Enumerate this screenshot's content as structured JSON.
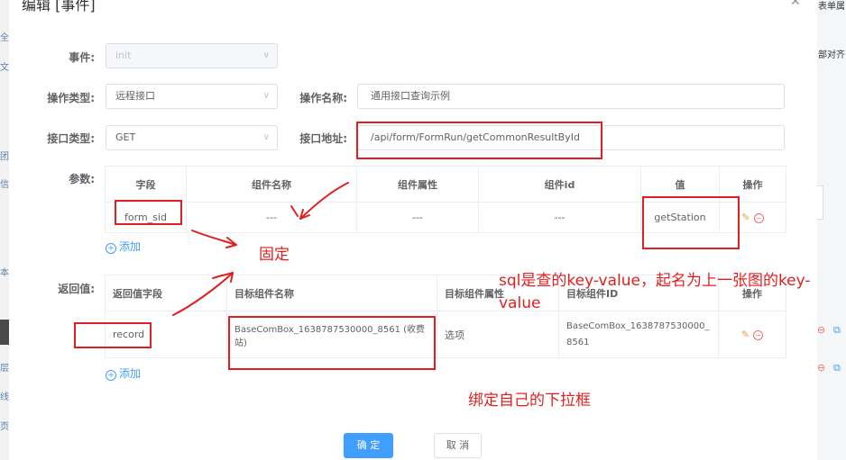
{
  "dialog": {
    "title": "编辑 [事件]"
  },
  "bg": {
    "left_chars": [
      "全",
      "文",
      "团",
      "信",
      "本",
      "层",
      "线",
      "页"
    ],
    "right_top": "表单属",
    "right_mid": "部对齐"
  },
  "form": {
    "event_label": "事件:",
    "event_value": "init",
    "op_type_label": "操作类型:",
    "op_type_value": "远程接口",
    "op_name_label": "操作名称:",
    "op_name_value": "通用接口查询示例",
    "api_type_label": "接口类型:",
    "api_type_value": "GET",
    "api_url_label": "接口地址:",
    "api_url_value": "/api/form/FormRun/getCommonResultById",
    "params_label": "参数:",
    "returns_label": "返回值:"
  },
  "params_table": {
    "headers": [
      "字段",
      "组件名称",
      "组件属性",
      "组件id",
      "值",
      "操作"
    ],
    "row": [
      "form_sid",
      "---",
      "---",
      "---",
      "getStation"
    ]
  },
  "returns_table": {
    "headers": [
      "返回值字段",
      "目标组件名称",
      "目标组件属性",
      "目标组件ID",
      "操作"
    ],
    "row": [
      "record",
      "BaseComBox_1638787530000_8561 (收费站)",
      "选项",
      "BaseComBox_1638787530000_8561"
    ]
  },
  "add_label": "添加",
  "annotations": {
    "fixed": "固定",
    "sql_note": "sql是查的key-value，起名为上一张图的key-value",
    "bind_note": "绑定自己的下拉框"
  },
  "footer": {
    "confirm": "确 定",
    "cancel": "取 消"
  },
  "colors": {
    "primary": "#409eff",
    "annotation_red": "#e02020",
    "danger": "#f56c6c",
    "warning": "#e6a23c"
  }
}
